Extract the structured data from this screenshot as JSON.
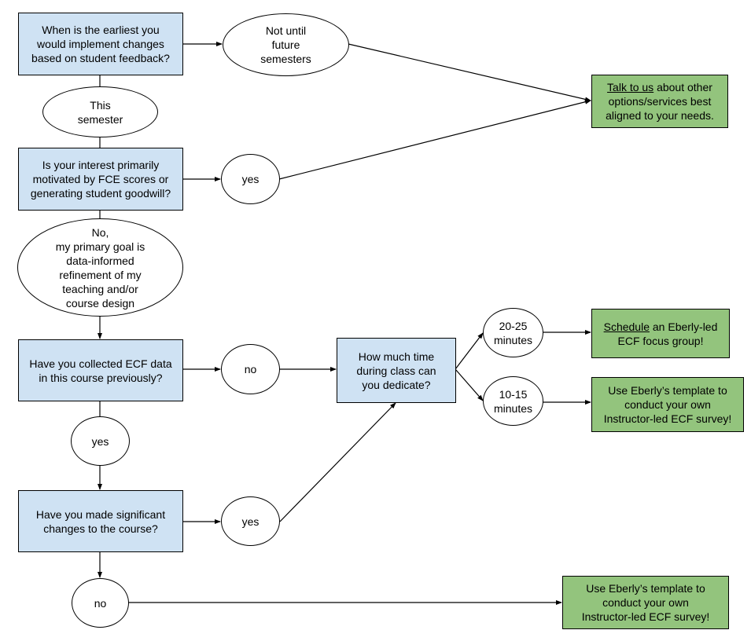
{
  "colors": {
    "question_fill": "#cfe2f3",
    "result_fill": "#93c47d",
    "stroke": "#000000"
  },
  "questions": {
    "q1": "When is the earliest you\nwould implement changes\nbased on student feedback?",
    "q2": "Is your interest primarily\nmotivated by FCE scores or\ngenerating student goodwill?",
    "q3": "Have you collected ECF data\nin this course previously?",
    "q4": "How much time\nduring class can\nyou dedicate?",
    "q5": "Have you made significant\nchanges to the course?"
  },
  "answers": {
    "not_until": "Not until\nfuture\nsemesters",
    "this_semester": "This\nsemester",
    "fce_yes": "yes",
    "no_primary_goal": "No,\nmy primary goal is\ndata-informed\nrefinement of my\nteaching and/or\ncourse design",
    "ecf_no": "no",
    "ecf_yes": "yes",
    "time_20_25": "20-25\nminutes",
    "time_10_15": "10-15\nminutes",
    "changes_yes": "yes",
    "changes_no": "no"
  },
  "results": {
    "talk": {
      "link": "Talk to us",
      "text": " about other\noptions/services best\naligned to your needs."
    },
    "schedule": {
      "link": "Schedule",
      "text": " an Eberly-led\nECF focus group!"
    },
    "template_a": "Use Eberly’s template to\nconduct your own\nInstructor-led ECF survey!",
    "template_b": "Use Eberly’s template to\nconduct your own\nInstructor-led ECF survey!"
  }
}
